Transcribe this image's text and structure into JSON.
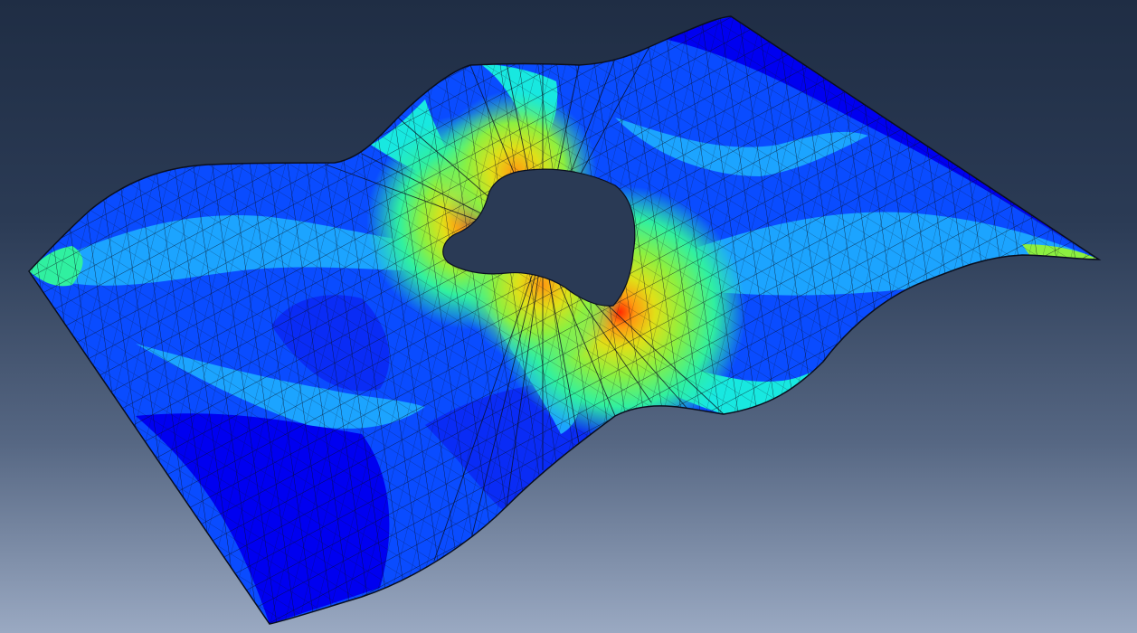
{
  "viewport": {
    "background_top": "#1f2d44",
    "background_bottom": "#9aa9c2"
  },
  "model": {
    "type": "deformed plate with central hole",
    "mesh_line_color": "#0a0f1e",
    "contour_colors": [
      "#0000ff",
      "#0a4cff",
      "#1ca4ff",
      "#18e8e0",
      "#30f0a0",
      "#8cf040",
      "#e0e018",
      "#ff9a10",
      "#ff2a00"
    ]
  }
}
